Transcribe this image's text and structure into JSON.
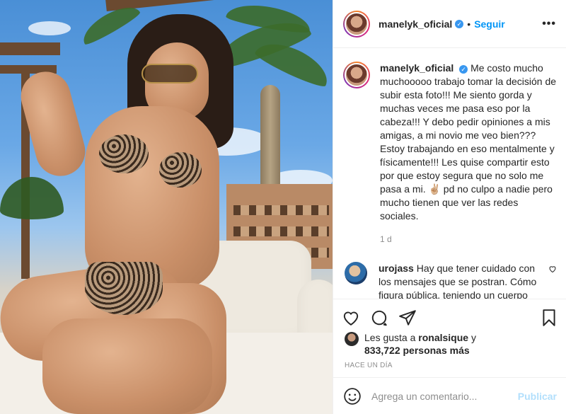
{
  "post": {
    "username": "manelyk_oficial",
    "verified_icon": "verified-badge-icon",
    "follow_label": "Seguir",
    "separator": "•",
    "more_label": "•••"
  },
  "caption": {
    "username": "manelyk_oficial",
    "text": "Me costo mucho muchooooo trabajo tomar la decisión de subir esta foto!!! Me siento gorda y muchas veces me pasa eso por la cabeza!!! Y debo pedir opiniones a mis amigas, a mi novio me veo bien??? Estoy trabajando en eso mentalmente y físicamente!!! Les quise compartir esto por que estoy segura que no solo me pasa a mi. ✌🏼 pd no culpo a nadie pero mucho tienen que ver las redes sociales.",
    "time": "1 d"
  },
  "comment": {
    "username": "urojass",
    "text": "Hay que tener cuidado con los mensajes que se postran. Cómo figura pública, teniendo un cuerpo bonito"
  },
  "likes": {
    "prefix": "Les gusta a",
    "user": "ronalsique",
    "conj": "y",
    "count": "833,722 personas más"
  },
  "posted_ago": "HACE UN DÍA",
  "add_comment": {
    "placeholder": "Agrega un comentario...",
    "publish_label": "Publicar"
  },
  "colors": {
    "accent": "#0095f6",
    "publish_disabled": "#b2dffc",
    "muted": "#8e8e8e",
    "text": "#262626"
  }
}
